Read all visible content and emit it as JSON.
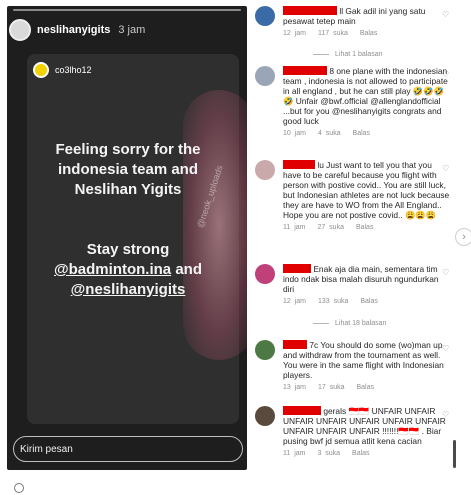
{
  "story": {
    "username": "neslihanyigits",
    "time": "3 jam",
    "inner_username": "co3lho12",
    "headline": "Feeling sorry for the indonesia team and Neslihan Yigits",
    "sub_prefix": "Stay strong",
    "link1": "@badminton.ina",
    "sub_and": "and",
    "link2": "@neslihanyigits",
    "reply_placeholder": "Kirim pesan",
    "watermark": "@neok_uploads"
  },
  "comments": [
    {
      "text": "ll Gak adil ini yang satu pesawat tetep main",
      "time": "12 jam",
      "likes": "117 suka",
      "reply": "Balas"
    },
    {
      "text": "8 one plane with the indonesian team , indonesia is not allowed to participate in all england , but he can still play 🤣🤣🤣🤣 Unfair @bwf.official @allenglandofficial ...but for you @neslihanyigits congrats and good luck",
      "time": "10 jam",
      "likes": "4 suka",
      "reply": "Balas"
    },
    {
      "text": "lu Just want to tell you that you have to be careful because you flight with person with postive covid.. You are still luck, but Indonesian athletes are not luck because they are have to WO from the All England.. Hope you are not postive covid.. 😩😩😩",
      "time": "11 jam",
      "likes": "27 suka",
      "reply": "Balas"
    },
    {
      "text": "Enak aja dia main, sementara tim indo ndak bisa malah disuruh ngundurkan diri",
      "time": "12 jam",
      "likes": "133 suka",
      "reply": "Balas"
    },
    {
      "text": "7c You should do some (wo)man up and withdraw from the tournament as well. You were in the same flight with Indonesian players.",
      "time": "13 jam",
      "likes": "17 suka",
      "reply": "Balas"
    },
    {
      "text": "gerals 🇮🇩🇮🇩 UNFAIR UNFAIR UNFAIR UNFAIR UNFAIR UNFAIR UNFAIR UNFAIR UNFAIR UNFAIR !!!!!!!🇮🇩🇮🇩 . Biar pusing bwf jd semua atlit kena cacian",
      "time": "11 jam",
      "likes": "3 suka",
      "reply": "Balas"
    }
  ],
  "view_replies": [
    "Lihat 1 balasan",
    "Lihat 18 balasan"
  ],
  "colors": {
    "story_bg": "#1e1e1e",
    "redaction": "#e10000",
    "meta": "#8e8e8e"
  }
}
